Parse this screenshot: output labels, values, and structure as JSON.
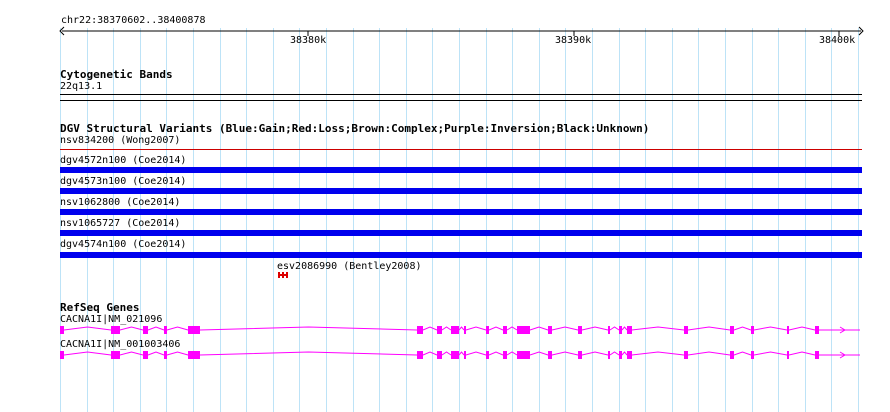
{
  "ruler": {
    "location": "chr22:38370602..38400878",
    "ticks": [
      "38380k",
      "38390k",
      "38400k"
    ]
  },
  "cytoband": {
    "title": "Cytogenetic Bands",
    "band": "22q13.1"
  },
  "dgv": {
    "title": "DGV Structural Variants (Blue:Gain;Red:Loss;Brown:Complex;Purple:Inversion;Black:Unknown)",
    "features": [
      {
        "label": "nsv834200 (Wong2007)",
        "color": "#cc0000",
        "style": "thin"
      },
      {
        "label": "dgv4572n100 (Coe2014)",
        "color": "#0000ee",
        "style": "bar"
      },
      {
        "label": "dgv4573n100 (Coe2014)",
        "color": "#0000ee",
        "style": "bar"
      },
      {
        "label": "nsv1062800 (Coe2014)",
        "color": "#0000ee",
        "style": "bar"
      },
      {
        "label": "nsv1065727 (Coe2014)",
        "color": "#0000ee",
        "style": "bar"
      },
      {
        "label": "dgv4574n100 (Coe2014)",
        "color": "#0000ee",
        "style": "bar"
      }
    ],
    "small_feature": {
      "label": "esv2086990 (Bentley2008)",
      "color": "#dd0000"
    }
  },
  "refseq": {
    "title": "RefSeq Genes",
    "color": "#ff00ff",
    "transcripts": [
      {
        "label": "CACNA1I|NM_021096"
      },
      {
        "label": "CACNA1I|NM_001003406"
      }
    ]
  }
}
